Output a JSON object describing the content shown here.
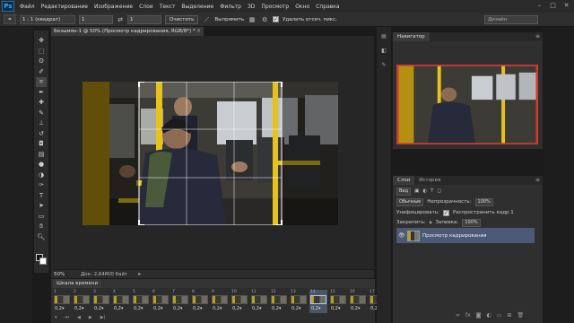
{
  "app": {
    "logo": "Ps",
    "menu": [
      "Файл",
      "Редактирование",
      "Изображение",
      "Слои",
      "Текст",
      "Выделение",
      "Фильтр",
      "3D",
      "Просмотр",
      "Окно",
      "Справка"
    ],
    "window_controls": [
      "–",
      "□",
      "✕"
    ]
  },
  "options": {
    "ratio": "1 : 1 (квадрат)",
    "width_value": "1",
    "height_value": "1",
    "clear_label": "Очистить",
    "straighten_label": "Выпрямить",
    "delete_pixels_label": "Удалить отсеч. пикс.",
    "delete_pixels_checked": true,
    "search_placeholder": "Дизайн"
  },
  "document": {
    "tab_title": "Безымян-1 @ 50% (Просмотр кадрирования, RGB/8*) *",
    "close": "×",
    "zoom": "50%",
    "doc_info": "Док: 2,64M/0 байт"
  },
  "toolbar": {
    "tools": [
      "move-tool",
      "marquee-tool",
      "lasso-tool",
      "quick-select-tool",
      "crop-tool",
      "eyedropper-tool",
      "healing-tool",
      "brush-tool",
      "clone-stamp-tool",
      "history-brush-tool",
      "eraser-tool",
      "gradient-tool",
      "blur-tool",
      "dodge-tool",
      "pen-tool",
      "type-tool",
      "path-select-tool",
      "shape-tool",
      "hand-tool",
      "zoom-tool"
    ],
    "active_tool": "crop-tool"
  },
  "timeline": {
    "title": "Шкала времени",
    "frames": [
      {
        "num": "1",
        "delay": "0,2"
      },
      {
        "num": "2",
        "delay": "0,2"
      },
      {
        "num": "3",
        "delay": "0,2"
      },
      {
        "num": "4",
        "delay": "0,2"
      },
      {
        "num": "5",
        "delay": "0,2"
      },
      {
        "num": "6",
        "delay": "0,2"
      },
      {
        "num": "7",
        "delay": "0,2"
      },
      {
        "num": "8",
        "delay": "0,2"
      },
      {
        "num": "9",
        "delay": "0,2"
      },
      {
        "num": "10",
        "delay": "0,2"
      },
      {
        "num": "11",
        "delay": "0,2"
      },
      {
        "num": "12",
        "delay": "0,2"
      },
      {
        "num": "13",
        "delay": "0,2"
      },
      {
        "num": "14",
        "delay": "0,2"
      },
      {
        "num": "15",
        "delay": "0,2"
      },
      {
        "num": "16",
        "delay": "0,2"
      },
      {
        "num": "17",
        "delay": "0,2"
      }
    ],
    "selected_frame": 14
  },
  "navigator": {
    "tab": "Навигатор"
  },
  "layers": {
    "tab_layers": "Слои",
    "tab_history": "История",
    "filter_kind": "Вид",
    "blend_mode": "Обычные",
    "opacity_label": "Непрозрачность:",
    "opacity_value": "100%",
    "unify_label": "Унифицировать:",
    "propagate_label": "Распространить кадр 1",
    "lock_label": "Закрепить:",
    "fill_label": "Заливка:",
    "fill_value": "100%",
    "layer_name": "Просмотр кадрирования"
  },
  "colors": {
    "accent": "#39a8ff",
    "nav_frame": "#d13a2f",
    "selected_layer": "#4c5a75",
    "pole": "#e6c21a"
  }
}
